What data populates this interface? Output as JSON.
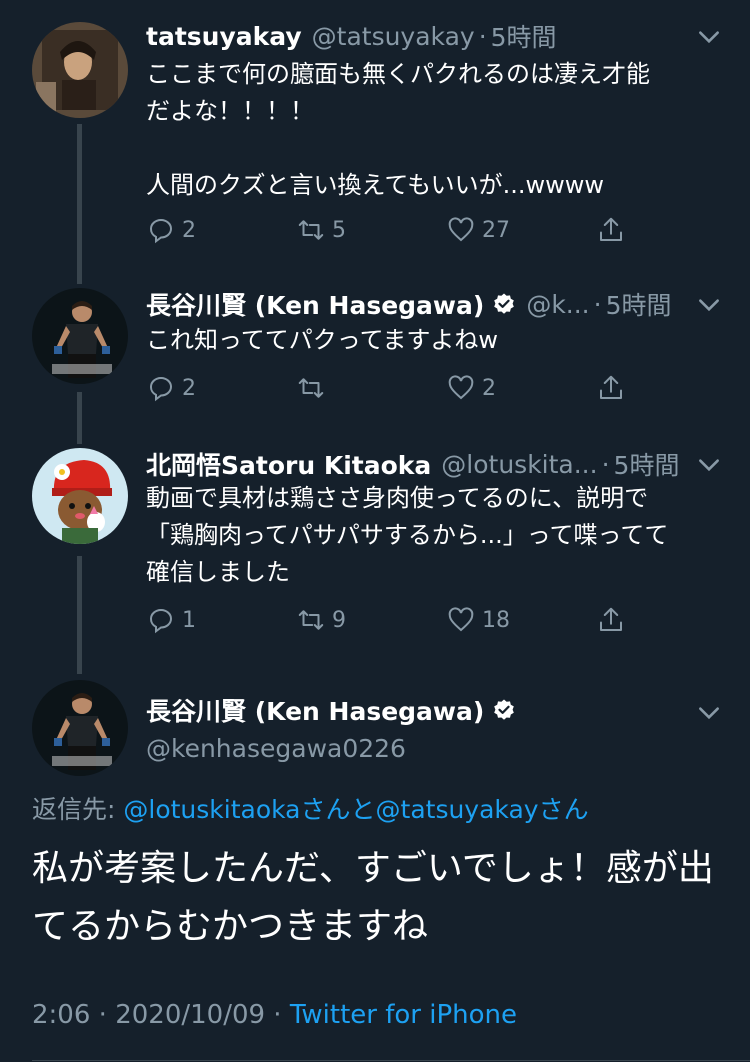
{
  "tweets": [
    {
      "name": "tatsuyakay",
      "handle": "@tatsuyakay",
      "sep": "·",
      "time": "5時間",
      "text": "ここまで何の臆面も無くパクれるのは凄え才能\nだよな！！！！\n\n人間のクズと言い換えてもいいが...wwww",
      "replies": "2",
      "retweets": "5",
      "likes": "27"
    },
    {
      "name": "長谷川賢 (Ken Hasegawa)",
      "handle": "@k...",
      "sep": "·",
      "time": "5時間",
      "text": "これ知っててパクってますよねw",
      "replies": "2",
      "retweets": "",
      "likes": "2"
    },
    {
      "name": "北岡悟Satoru Kitaoka",
      "handle": "@lotuskita...",
      "sep": "·",
      "time": "5時間",
      "text": "動画で具材は鶏ささ身肉使ってるのに、説明で\n「鶏胸肉ってパサパサするから...」って喋ってて\n確信しました",
      "replies": "1",
      "retweets": "9",
      "likes": "18"
    }
  ],
  "focus": {
    "name": "長谷川賢 (Ken Hasegawa)",
    "handle": "@kenhasegawa0226",
    "reply_prefix": "返信先: ",
    "reply_user1": "@lotuskitaoka",
    "reply_mid": "さんと",
    "reply_user2": "@tatsuyakay",
    "reply_suffix": "さん",
    "text": "私が考案したんだ、すごいでしょ！感が出てるからむかつきますね",
    "time": "2:06",
    "sep1": " · ",
    "date": "2020/10/09",
    "sep2": " · ",
    "source": "Twitter for iPhone"
  },
  "colors": {
    "background": "#15202b",
    "secondary_text": "#8899a6",
    "link": "#1da1f2"
  }
}
